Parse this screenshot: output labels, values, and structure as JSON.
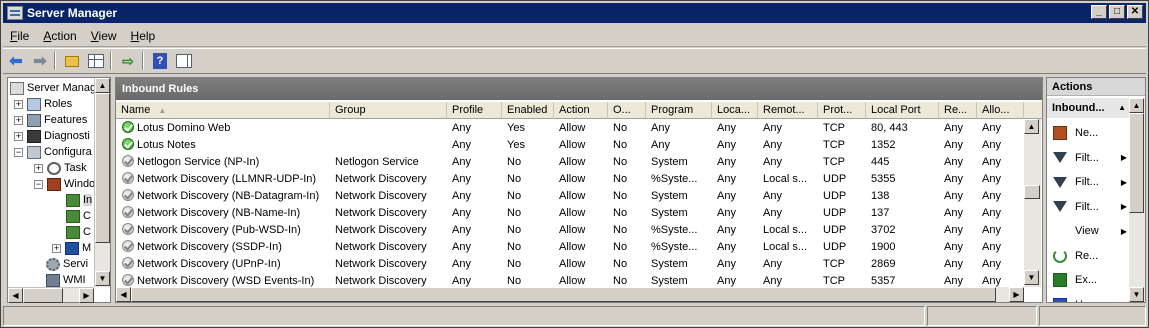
{
  "window": {
    "title": "Server Manager"
  },
  "menu": [
    {
      "label": "File",
      "accel": "F",
      "rest": "ile"
    },
    {
      "label": "Action",
      "accel": "A",
      "rest": "ction"
    },
    {
      "label": "View",
      "accel": "V",
      "rest": "iew"
    },
    {
      "label": "Help",
      "accel": "H",
      "rest": "elp"
    }
  ],
  "tree": [
    {
      "label": "Server Manag",
      "icon": "server-icon"
    },
    {
      "label": "Roles",
      "icon": "roles-icon"
    },
    {
      "label": "Features",
      "icon": "features-icon"
    },
    {
      "label": "Diagnosti",
      "icon": "diagnostics-icon"
    },
    {
      "label": "Configura",
      "icon": "configuration-icon"
    },
    {
      "label": "Task",
      "icon": "task-scheduler-icon"
    },
    {
      "label": "Windo",
      "icon": "firewall-icon"
    },
    {
      "label": "In",
      "icon": "inbound-rules-icon"
    },
    {
      "label": "C",
      "icon": "outbound-rules-icon"
    },
    {
      "label": "C",
      "icon": "connection-rules-icon"
    },
    {
      "label": "M",
      "icon": "monitoring-icon"
    },
    {
      "label": "Servi",
      "icon": "services-icon"
    },
    {
      "label": "WMI",
      "icon": "wmi-icon"
    }
  ],
  "center": {
    "title": "Inbound Rules",
    "columns": [
      "Name",
      "Group",
      "Profile",
      "Enabled",
      "Action",
      "O...",
      "Program",
      "Loca...",
      "Remot...",
      "Prot...",
      "Local Port",
      "Re...",
      "Allo..."
    ],
    "rows": [
      {
        "status": "enabled",
        "cells": [
          "Lotus Domino Web",
          "",
          "Any",
          "Yes",
          "Allow",
          "No",
          "Any",
          "Any",
          "Any",
          "TCP",
          "80, 443",
          "Any",
          "Any"
        ]
      },
      {
        "status": "enabled",
        "cells": [
          "Lotus Notes",
          "",
          "Any",
          "Yes",
          "Allow",
          "No",
          "Any",
          "Any",
          "Any",
          "TCP",
          "1352",
          "Any",
          "Any"
        ]
      },
      {
        "status": "disabled",
        "cells": [
          "Netlogon Service (NP-In)",
          "Netlogon Service",
          "Any",
          "No",
          "Allow",
          "No",
          "System",
          "Any",
          "Any",
          "TCP",
          "445",
          "Any",
          "Any"
        ]
      },
      {
        "status": "disabled",
        "cells": [
          "Network Discovery (LLMNR-UDP-In)",
          "Network Discovery",
          "Any",
          "No",
          "Allow",
          "No",
          "%Syste...",
          "Any",
          "Local s...",
          "UDP",
          "5355",
          "Any",
          "Any"
        ]
      },
      {
        "status": "disabled",
        "cells": [
          "Network Discovery (NB-Datagram-In)",
          "Network Discovery",
          "Any",
          "No",
          "Allow",
          "No",
          "System",
          "Any",
          "Any",
          "UDP",
          "138",
          "Any",
          "Any"
        ]
      },
      {
        "status": "disabled",
        "cells": [
          "Network Discovery (NB-Name-In)",
          "Network Discovery",
          "Any",
          "No",
          "Allow",
          "No",
          "System",
          "Any",
          "Any",
          "UDP",
          "137",
          "Any",
          "Any"
        ]
      },
      {
        "status": "disabled",
        "cells": [
          "Network Discovery (Pub-WSD-In)",
          "Network Discovery",
          "Any",
          "No",
          "Allow",
          "No",
          "%Syste...",
          "Any",
          "Local s...",
          "UDP",
          "3702",
          "Any",
          "Any"
        ]
      },
      {
        "status": "disabled",
        "cells": [
          "Network Discovery (SSDP-In)",
          "Network Discovery",
          "Any",
          "No",
          "Allow",
          "No",
          "%Syste...",
          "Any",
          "Local s...",
          "UDP",
          "1900",
          "Any",
          "Any"
        ]
      },
      {
        "status": "disabled",
        "cells": [
          "Network Discovery (UPnP-In)",
          "Network Discovery",
          "Any",
          "No",
          "Allow",
          "No",
          "System",
          "Any",
          "Any",
          "TCP",
          "2869",
          "Any",
          "Any"
        ]
      },
      {
        "status": "disabled",
        "cells": [
          "Network Discovery (WSD Events-In)",
          "Network Discovery",
          "Any",
          "No",
          "Allow",
          "No",
          "System",
          "Any",
          "Any",
          "TCP",
          "5357",
          "Any",
          "Any"
        ]
      }
    ]
  },
  "actions": {
    "title": "Actions",
    "group": "Inbound...",
    "items": [
      {
        "label": "Ne...",
        "icon": "new-rule-icon",
        "submenu": false
      },
      {
        "label": "Filt...",
        "icon": "filter-icon",
        "submenu": true
      },
      {
        "label": "Filt...",
        "icon": "filter-icon",
        "submenu": true
      },
      {
        "label": "Filt...",
        "icon": "filter-icon",
        "submenu": true
      },
      {
        "label": "View",
        "icon": "view-icon",
        "submenu": true
      },
      {
        "label": "Re...",
        "icon": "refresh-icon",
        "submenu": false
      },
      {
        "label": "Ex...",
        "icon": "export-icon",
        "submenu": false
      },
      {
        "label": "H...",
        "icon": "help-icon",
        "submenu": false
      }
    ]
  }
}
